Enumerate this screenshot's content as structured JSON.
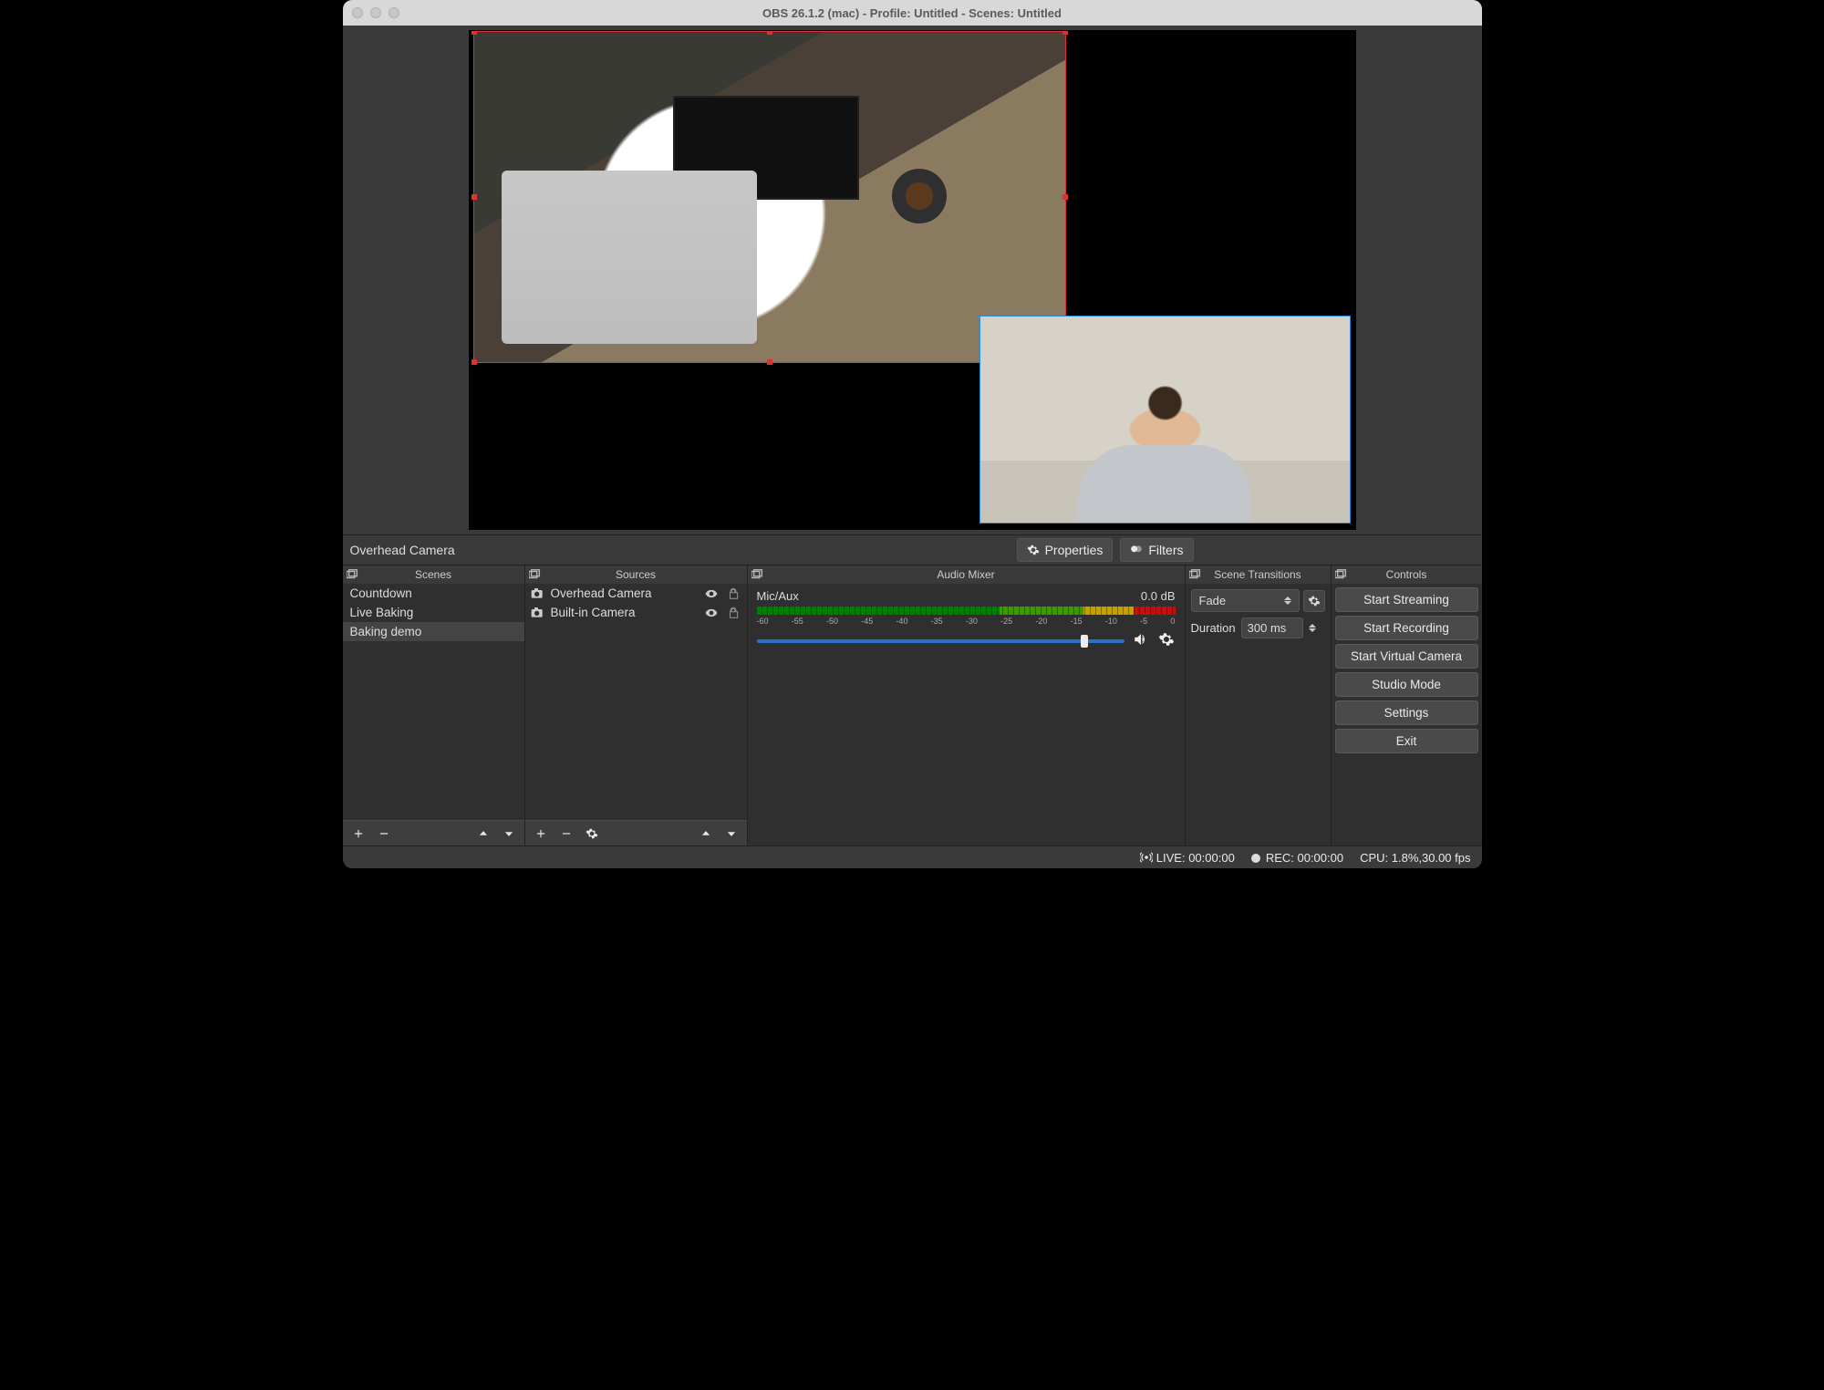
{
  "window": {
    "title": "OBS 26.1.2 (mac) - Profile: Untitled - Scenes: Untitled"
  },
  "midbar": {
    "selected_source": "Overhead Camera",
    "properties_label": "Properties",
    "filters_label": "Filters"
  },
  "panels": {
    "scenes": {
      "title": "Scenes",
      "items": [
        "Countdown",
        "Live Baking",
        "Baking demo"
      ],
      "selected_index": 2
    },
    "sources": {
      "title": "Sources",
      "items": [
        {
          "name": "Overhead Camera",
          "visible": true,
          "locked": false
        },
        {
          "name": "Built-in Camera",
          "visible": true,
          "locked": false
        }
      ]
    },
    "mixer": {
      "title": "Audio Mixer",
      "channel": {
        "name": "Mic/Aux",
        "level": "0.0 dB"
      },
      "ticks": [
        "-60",
        "-55",
        "-50",
        "-45",
        "-40",
        "-35",
        "-30",
        "-25",
        "-20",
        "-15",
        "-10",
        "-5",
        "0"
      ]
    },
    "transitions": {
      "title": "Scene Transitions",
      "selected": "Fade",
      "duration_label": "Duration",
      "duration_value": "300 ms"
    },
    "controls": {
      "title": "Controls",
      "buttons": [
        "Start Streaming",
        "Start Recording",
        "Start Virtual Camera",
        "Studio Mode",
        "Settings",
        "Exit"
      ]
    }
  },
  "status": {
    "live": "LIVE: 00:00:00",
    "rec": "REC: 00:00:00",
    "cpu": "CPU: 1.8%,30.00 fps"
  }
}
